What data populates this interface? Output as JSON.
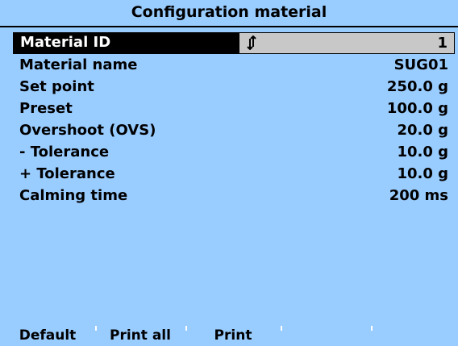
{
  "header": {
    "title": "Configuration material"
  },
  "rows": [
    {
      "label": "Material ID",
      "value": "1",
      "selected": true
    },
    {
      "label": "Material name",
      "value": "SUG01"
    },
    {
      "label": "Set point",
      "value": "250.0 g"
    },
    {
      "label": "Preset",
      "value": "100.0 g"
    },
    {
      "label": "Overshoot (OVS)",
      "value": "20.0 g"
    },
    {
      "label": "- Tolerance",
      "value": "10.0 g"
    },
    {
      "label": "+ Tolerance",
      "value": "10.0 g"
    },
    {
      "label": "Calming time",
      "value": "200 ms"
    }
  ],
  "selected_row_icon": "up-down-arrows-icon",
  "softkeys": [
    {
      "label": "Default"
    },
    {
      "label": "Print all"
    },
    {
      "label": "Print"
    },
    {
      "label": ""
    },
    {
      "label": ""
    }
  ],
  "colors": {
    "background": "#99ccff",
    "selection_label_bg": "#000000",
    "selection_value_bg": "#c8c8c8"
  }
}
